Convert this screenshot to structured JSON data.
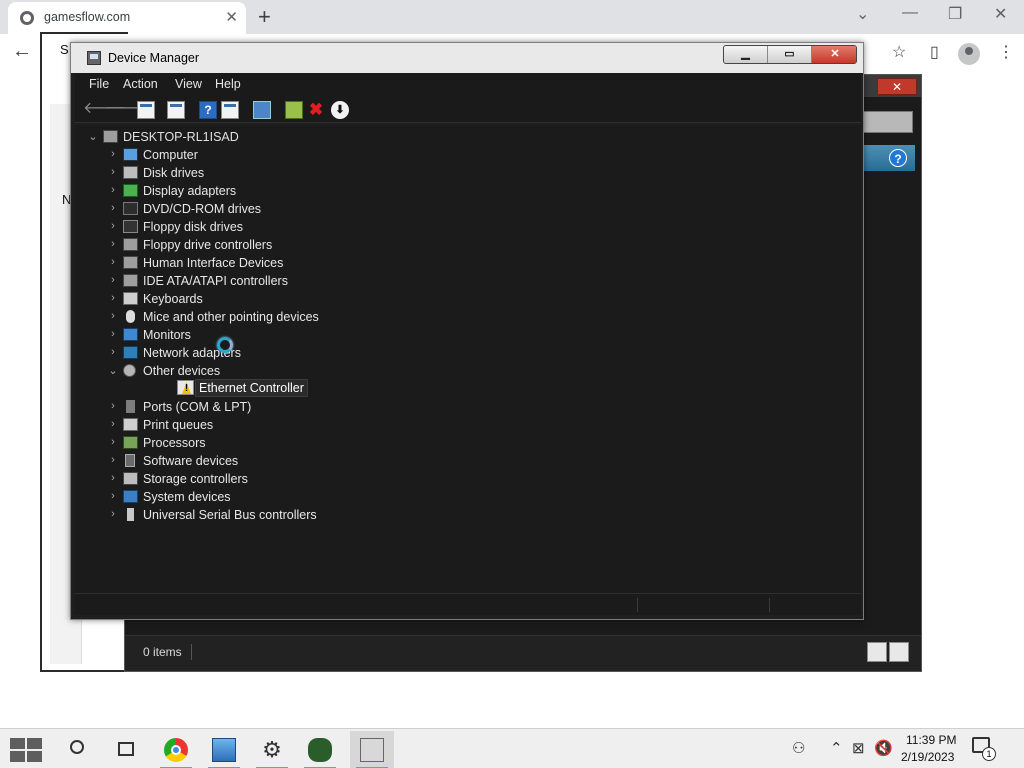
{
  "browser": {
    "tab_title": "gamesflow.com",
    "tab_close": "✕",
    "new_tab": "+",
    "minimize": "—",
    "restore": "❐",
    "close": "✕",
    "back": "←",
    "icons": [
      "share-icon",
      "star-icon",
      "side-panel-icon",
      "profile-icon",
      "menu-icon"
    ]
  },
  "background_window": {
    "fragments": [
      "S",
      "N"
    ],
    "status_text": "0 items",
    "close_glyph": "✕",
    "help_glyph": "?"
  },
  "device_manager": {
    "title": "Device Manager",
    "controls": {
      "minimize": "▁",
      "maximize": "▭",
      "close": "✕"
    },
    "menu": [
      "File",
      "Action",
      "View",
      "Help"
    ],
    "toolbar": [
      {
        "name": "back",
        "glyph": "🡐"
      },
      {
        "name": "forward",
        "glyph": "🡒"
      },
      {
        "name": "show-hide-console-tree",
        "glyph": ""
      },
      {
        "name": "properties",
        "glyph": ""
      },
      {
        "name": "help",
        "glyph": "?"
      },
      {
        "name": "show-hide-action-pane",
        "glyph": ""
      },
      {
        "name": "scan-for-hardware-changes",
        "glyph": ""
      },
      {
        "name": "add-legacy-hardware",
        "glyph": ""
      },
      {
        "name": "uninstall-device",
        "glyph": "✖"
      },
      {
        "name": "update-driver",
        "glyph": "⬇"
      }
    ],
    "root": {
      "label": "DESKTOP-RL1ISAD",
      "chevron": "⌄"
    },
    "categories": [
      {
        "label": "Computer",
        "icon": "computer-icon",
        "chevron": "›"
      },
      {
        "label": "Disk drives",
        "icon": "disk-drive-icon",
        "chevron": "›"
      },
      {
        "label": "Display adapters",
        "icon": "display-adapter-icon",
        "chevron": "›"
      },
      {
        "label": "DVD/CD-ROM drives",
        "icon": "dvd-drive-icon",
        "chevron": "›"
      },
      {
        "label": "Floppy disk drives",
        "icon": "floppy-disk-icon",
        "chevron": "›"
      },
      {
        "label": "Floppy drive controllers",
        "icon": "floppy-controller-icon",
        "chevron": "›"
      },
      {
        "label": "Human Interface Devices",
        "icon": "hid-icon",
        "chevron": "›"
      },
      {
        "label": "IDE ATA/ATAPI controllers",
        "icon": "ide-controller-icon",
        "chevron": "›"
      },
      {
        "label": "Keyboards",
        "icon": "keyboard-icon",
        "chevron": "›"
      },
      {
        "label": "Mice and other pointing devices",
        "icon": "mouse-icon",
        "chevron": "›"
      },
      {
        "label": "Monitors",
        "icon": "monitor-icon",
        "chevron": "›"
      },
      {
        "label": "Network adapters",
        "icon": "network-adapter-icon",
        "chevron": "›"
      },
      {
        "label": "Other devices",
        "icon": "other-devices-icon",
        "chevron": "⌄"
      },
      {
        "label": "Ports (COM & LPT)",
        "icon": "ports-icon",
        "chevron": "›"
      },
      {
        "label": "Print queues",
        "icon": "print-queue-icon",
        "chevron": "›"
      },
      {
        "label": "Processors",
        "icon": "processor-icon",
        "chevron": "›"
      },
      {
        "label": "Software devices",
        "icon": "software-device-icon",
        "chevron": "›"
      },
      {
        "label": "Storage controllers",
        "icon": "storage-controller-icon",
        "chevron": "›"
      },
      {
        "label": "System devices",
        "icon": "system-device-icon",
        "chevron": "›"
      },
      {
        "label": "Universal Serial Bus controllers",
        "icon": "usb-icon",
        "chevron": "›"
      }
    ],
    "expanded_child": {
      "label": "Ethernet Controller",
      "icon": "warning-device-icon",
      "status": "unknown-device"
    }
  },
  "taskbar": {
    "apps": [
      "start-icon",
      "search-icon",
      "task-view-icon",
      "chrome-icon",
      "remote-desktop-icon",
      "settings-icon",
      "game-icon",
      "device-manager-icon"
    ],
    "settings_glyph": "⚙",
    "people_glyph": "⚇",
    "tray_chevron": "⌃",
    "network_glyph": "⊠",
    "volume_glyph": "🔇",
    "time": "11:39 PM",
    "date": "2/19/2023",
    "notification_count": "1"
  },
  "colors": {
    "dm_background": "#1b1b1b",
    "dm_titlebar": "#e9e9e9",
    "close_red": "#c3392b",
    "warning_yellow": "#f2c200"
  }
}
